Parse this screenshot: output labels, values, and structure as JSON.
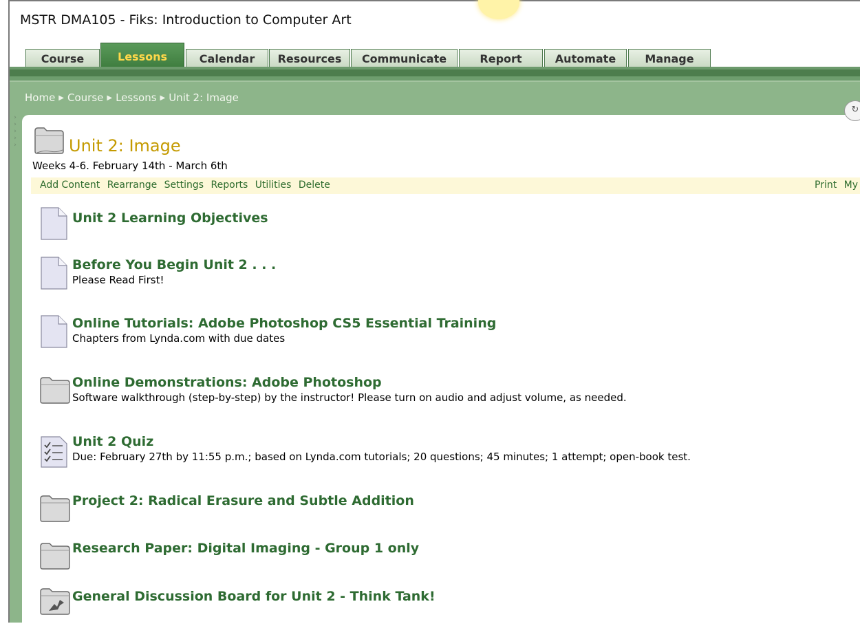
{
  "course_title": "MSTR DMA105 - Fiks: Introduction to Computer Art",
  "tabs": [
    {
      "label": "Course",
      "active": false
    },
    {
      "label": "Lessons",
      "active": true
    },
    {
      "label": "Calendar",
      "active": false
    },
    {
      "label": "Resources",
      "active": false
    },
    {
      "label": "Communicate",
      "active": false
    },
    {
      "label": "Report",
      "active": false
    },
    {
      "label": "Automate",
      "active": false
    },
    {
      "label": "Manage",
      "active": false
    }
  ],
  "breadcrumb": [
    "Home",
    "Course",
    "Lessons",
    "Unit 2: Image"
  ],
  "unit": {
    "title": "Unit 2: Image",
    "subtitle": "Weeks 4-6. February 14th - March 6th"
  },
  "actions_left": [
    "Add Content",
    "Rearrange",
    "Settings",
    "Reports",
    "Utilities",
    "Delete"
  ],
  "actions_right": [
    "Print",
    "My N"
  ],
  "items": [
    {
      "icon": "document-icon",
      "title": "Unit 2 Learning Objectives",
      "desc": ""
    },
    {
      "icon": "document-icon",
      "title": "Before You Begin Unit 2 . . .",
      "desc": "Please Read First!"
    },
    {
      "icon": "document-icon",
      "title": "Online Tutorials: Adobe Photoshop CS5 Essential Training",
      "desc": "Chapters from Lynda.com with due dates"
    },
    {
      "icon": "folder-icon",
      "title": "Online Demonstrations: Adobe Photoshop",
      "desc": "Software walkthrough (step-by-step) by the instructor! Please turn on audio and adjust volume, as needed."
    },
    {
      "icon": "quiz-icon",
      "title": "Unit 2 Quiz",
      "desc": "Due: February 27th by 11:55 p.m.; based on Lynda.com tutorials; 20 questions; 45 minutes; 1 attempt; open-book test."
    },
    {
      "icon": "folder-icon",
      "title": "Project 2: Radical Erasure and Subtle Addition",
      "desc": ""
    },
    {
      "icon": "folder-icon",
      "title": "Research Paper: Digital Imaging - Group 1 only",
      "desc": ""
    },
    {
      "icon": "discussion-folder-icon",
      "title": "General Discussion Board for Unit 2 - Think Tank!",
      "desc": ""
    }
  ],
  "colors": {
    "tab_active_bg": "#4a8a4a",
    "tab_active_text": "#ffd84a",
    "green_band": "#8db58a",
    "item_title": "#2e6b32",
    "unit_title": "#c49a00",
    "action_bar_bg": "#fdf8d8"
  }
}
